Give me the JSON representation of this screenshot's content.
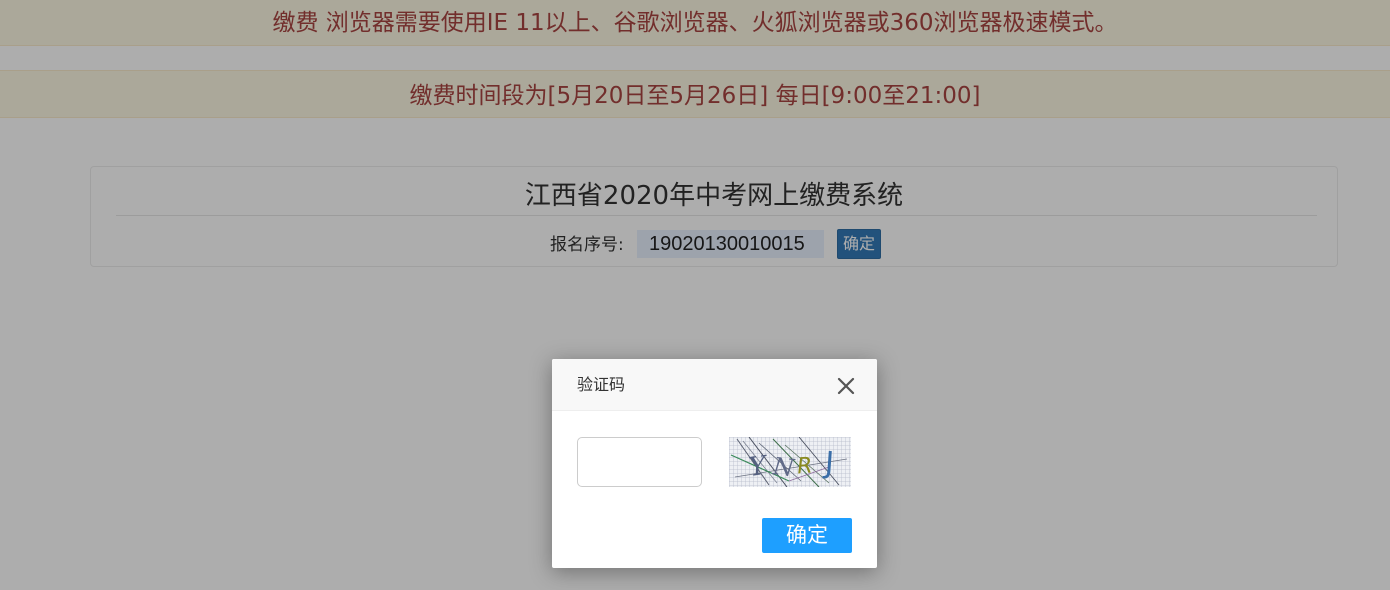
{
  "notices": {
    "browser_notice": "缴费 浏览器需要使用IE 11以上、谷歌浏览器、火狐浏览器或360浏览器极速模式。",
    "time_notice": "缴费时间段为[5月20日至5月26日] 每日[9:00至21:00]"
  },
  "panel": {
    "title": "江西省2020年中考网上缴费系统",
    "reg_label": "报名序号:",
    "reg_value": "19020130010015",
    "confirm_label": "确定"
  },
  "modal": {
    "title": "验证码",
    "close_icon": "close-icon",
    "captcha_input_value": "",
    "captcha_text": "YNRJ",
    "confirm_label": "确定"
  },
  "colors": {
    "notice_bg": "#fcf8e3",
    "notice_text": "#a94442",
    "primary_button": "#337ab7",
    "modal_button": "#1e9fff"
  }
}
